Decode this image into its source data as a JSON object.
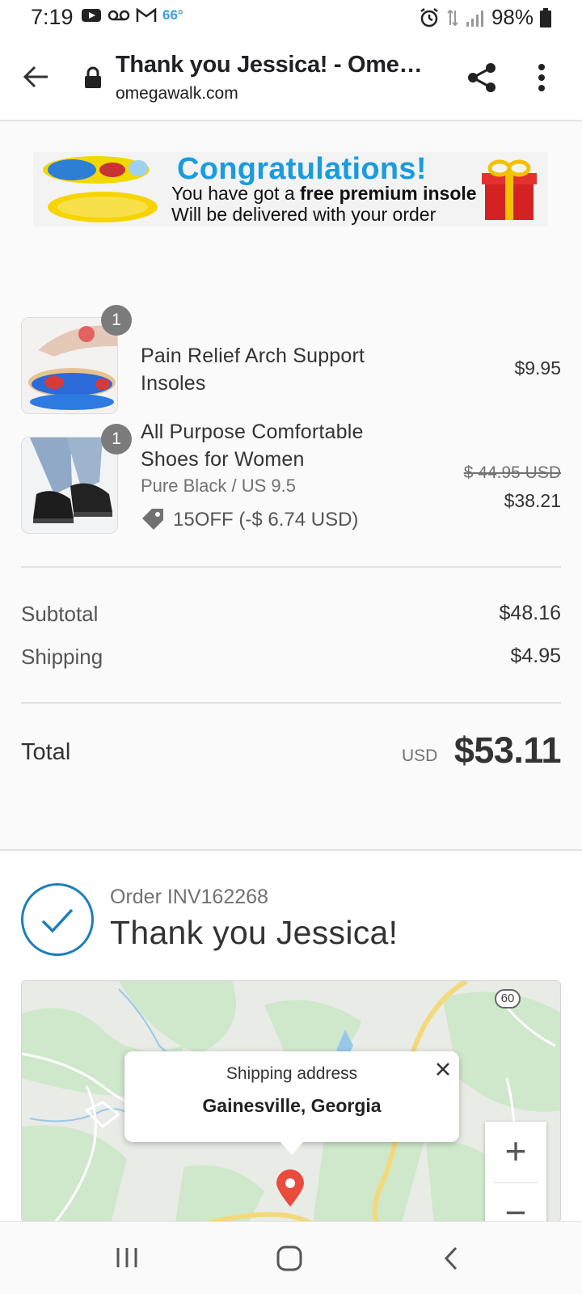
{
  "status_bar": {
    "time": "7:19",
    "temperature": "66°",
    "battery": "98%",
    "icons_left": [
      "youtube-icon",
      "voicemail-icon",
      "gmail-icon"
    ],
    "icons_right": [
      "alarm-icon",
      "data-icon",
      "signal-icon",
      "battery-icon"
    ]
  },
  "browser": {
    "page_title": "Thank you Jessica! - Omega...",
    "url": "omegawalk.com"
  },
  "banner": {
    "title": "Congratulations!",
    "line1_prefix": "You have got a ",
    "line1_bold": "free premium insole",
    "line2": "Will be delivered with your order"
  },
  "products": [
    {
      "name": "Pain Relief Arch Support Insoles",
      "quantity": "1",
      "price": "$9.95"
    },
    {
      "name": "All Purpose Comfortable Shoes for Women",
      "quantity": "1",
      "variant": "Pure Black / US 9.5",
      "discount": "15OFF (-$ 6.74 USD)",
      "original_price": "$ 44.95 USD",
      "price": "$38.21"
    }
  ],
  "summary": {
    "subtotal_label": "Subtotal",
    "subtotal": "$48.16",
    "shipping_label": "Shipping",
    "shipping": "$4.95",
    "total_label": "Total",
    "currency": "USD",
    "total": "$53.11"
  },
  "order": {
    "number": "Order INV162268",
    "thanks": "Thank you Jessica!"
  },
  "map": {
    "popup_subtitle": "Shipping address",
    "popup_location": "Gainesville, Georgia",
    "road_shield": "60",
    "zoom_in": "+",
    "zoom_out": "−"
  },
  "colors": {
    "accent_blue": "#1a9be0",
    "check_blue": "#1e7fb8",
    "marker_red": "#e94b3c"
  }
}
